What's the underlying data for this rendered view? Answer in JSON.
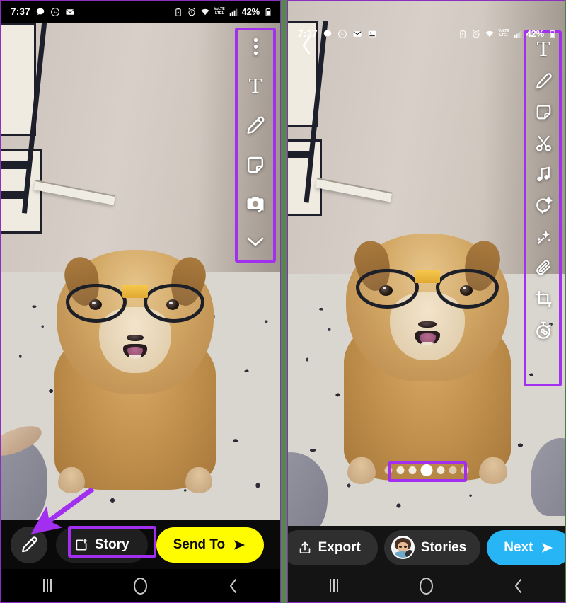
{
  "panels": {
    "left": {
      "name": "snapchat-send-screen",
      "statusbar": {
        "time": "7:37",
        "icons": [
          "chat-bubble-icon",
          "whatsapp-icon",
          "mail-icon"
        ],
        "right_icons": [
          "battery-saver-icon",
          "alarm-icon",
          "wifi-icon",
          "volte-icon",
          "signal-bars-icon",
          "battery-icon"
        ],
        "volte_top": "VoLTE",
        "volte_bottom": "LTE1",
        "battery_percent": "42%"
      },
      "toolbar": {
        "name": "snapchat-edit-toolbar",
        "items": [
          {
            "icon": "more-options-icon",
            "label": "More options"
          },
          {
            "icon": "text-icon",
            "label": "Text"
          },
          {
            "icon": "pencil-icon",
            "label": "Draw"
          },
          {
            "icon": "sticker-icon",
            "label": "Stickers"
          },
          {
            "icon": "camera-flip-icon",
            "label": "Flip camera"
          },
          {
            "icon": "chevron-down-icon",
            "label": "More tools"
          }
        ]
      },
      "bottom": {
        "edit_button": {
          "icon": "pencil-icon",
          "label": "Edit"
        },
        "story_button": {
          "icon": "add-to-story-icon",
          "label": "Story"
        },
        "send_button": {
          "label": "Send To",
          "icon": "send-arrow-icon",
          "color": "#fffc00"
        }
      },
      "navbar": {
        "recents": "recents-icon",
        "home": "home-icon",
        "back": "back-icon"
      }
    },
    "right": {
      "name": "photo-editor-screen",
      "statusbar": {
        "time": "7:37",
        "icons": [
          "chat-bubble-icon",
          "whatsapp-icon",
          "mail-icon",
          "gallery-icon"
        ],
        "right_icons": [
          "battery-saver-icon",
          "alarm-icon",
          "wifi-icon",
          "volte-icon",
          "signal-bars-icon",
          "battery-icon"
        ],
        "volte_top": "VoLTE",
        "volte_bottom": "LTE1",
        "battery_percent": "42%"
      },
      "back_icon": "back-chevron-icon",
      "toolbar": {
        "name": "editor-tool-rail",
        "items": [
          {
            "icon": "text-icon",
            "label": "Text"
          },
          {
            "icon": "pencil-icon",
            "label": "Draw"
          },
          {
            "icon": "sticker-icon",
            "label": "Stickers"
          },
          {
            "icon": "scissors-icon",
            "label": "Cutout"
          },
          {
            "icon": "music-note-icon",
            "label": "Music"
          },
          {
            "icon": "lens-star-icon",
            "label": "Lenses"
          },
          {
            "icon": "magic-wand-icon",
            "label": "Effects"
          },
          {
            "icon": "paperclip-icon",
            "label": "Attach link"
          },
          {
            "icon": "crop-icon",
            "label": "Crop"
          },
          {
            "icon": "timer-icon",
            "label": "Timer"
          }
        ]
      },
      "carousel": {
        "name": "filter-carousel",
        "total": 7,
        "active_index": 3
      },
      "bottom": {
        "export_button": {
          "icon": "export-icon",
          "label": "Export"
        },
        "stories_button": {
          "icon": "bitmoji-avatar",
          "label": "Stories"
        },
        "next_button": {
          "label": "Next",
          "icon": "next-arrow-icon",
          "color": "#28b5f5"
        }
      },
      "navbar": {
        "recents": "recents-icon",
        "home": "home-icon",
        "back": "back-icon"
      }
    }
  },
  "annotations": {
    "highlight_color": "#a22ff0",
    "arrow_color": "#a22ff0",
    "boxes": [
      "left-toolbar-highlight",
      "story-button-highlight",
      "right-toolbar-highlight",
      "carousel-highlight"
    ],
    "arrow_target": "edit-pencil-button"
  },
  "photo": {
    "subject": "golden dog wearing black glasses with yellow bridge",
    "scene": "terrazzo floor, beige wall, dark shelf"
  }
}
